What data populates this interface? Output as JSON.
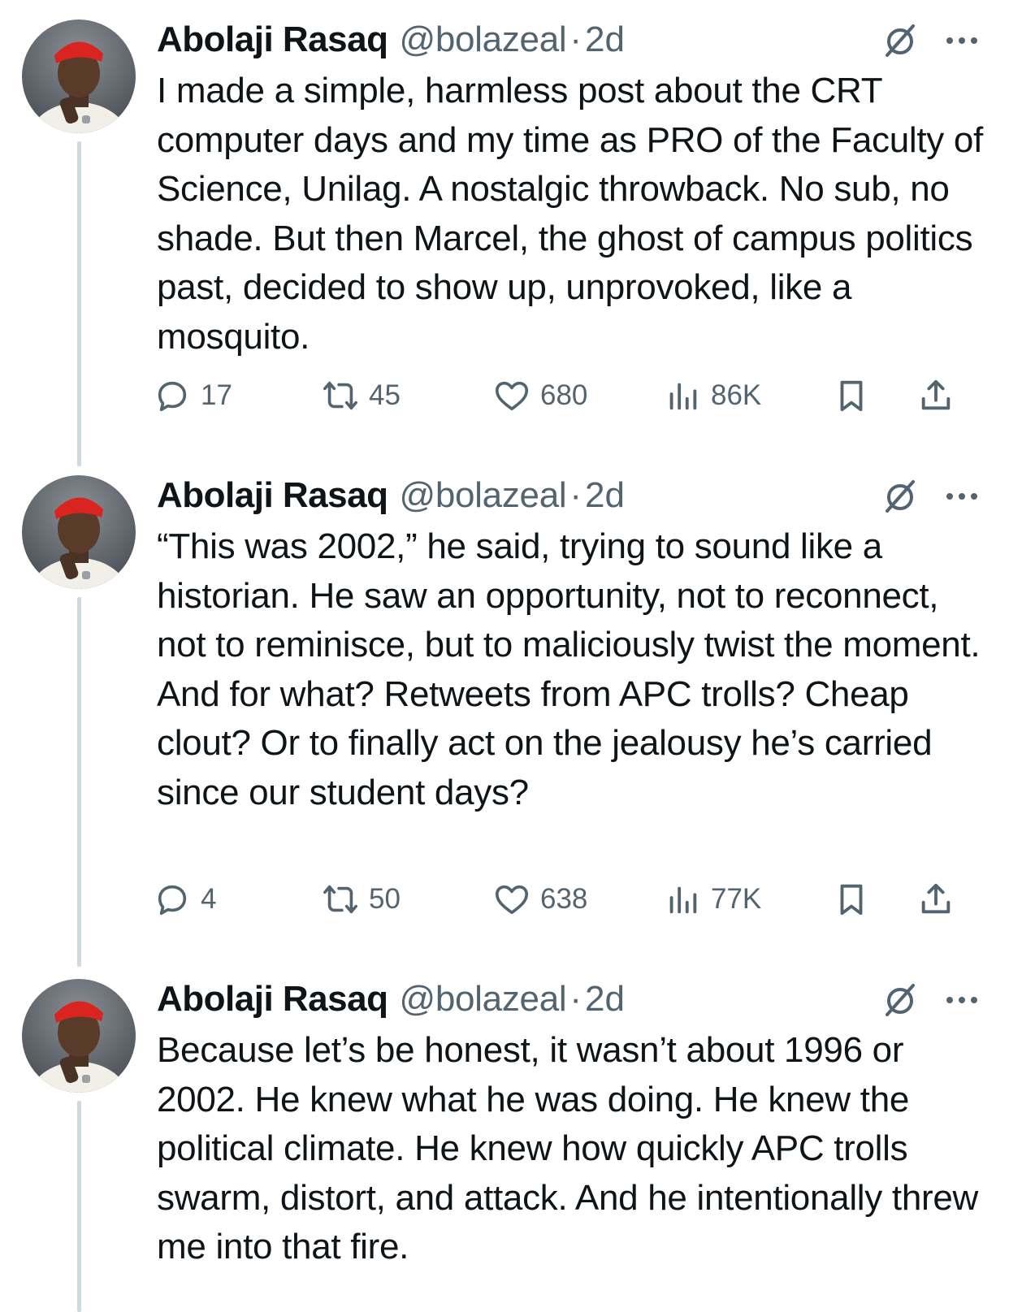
{
  "colors": {
    "text": "#0f1419",
    "secondary": "#536471",
    "thread_line": "#cfd9de"
  },
  "icons": [
    "grok-icon",
    "more-options-icon",
    "reply-icon",
    "retweet-icon",
    "like-icon",
    "views-icon",
    "bookmark-icon",
    "share-icon"
  ],
  "tweets": [
    {
      "author": "Abolaji Rasaq",
      "handle": "@bolazeal",
      "separator": "·",
      "time": "2d",
      "text": "I made a simple, harmless post about the CRT computer days and my time as PRO of the Faculty of Science, Unilag. A nostalgic throwback. No sub, no shade. But then Marcel, the ghost of campus politics past, decided to show up, unprovoked, like a mosquito.",
      "stats": {
        "replies": "17",
        "retweets": "45",
        "likes": "680",
        "views": "86K"
      }
    },
    {
      "author": "Abolaji Rasaq",
      "handle": "@bolazeal",
      "separator": "·",
      "time": "2d",
      "text": "“This was 2002,” he said, trying to sound like a historian. He saw an opportunity, not to reconnect, not to reminisce, but to maliciously twist the moment. And for what? Retweets from APC trolls? Cheap clout? Or to finally act on the jealousy he’s carried since our student days?",
      "stats": {
        "replies": "4",
        "retweets": "50",
        "likes": "638",
        "views": "77K"
      }
    },
    {
      "author": "Abolaji Rasaq",
      "handle": "@bolazeal",
      "separator": "·",
      "time": "2d",
      "text": "Because let’s be honest, it wasn’t about 1996 or 2002. He knew what he was doing. He knew the political climate. He knew how quickly APC trolls swarm, distort, and attack. And he intentionally threw me into that fire."
    }
  ]
}
